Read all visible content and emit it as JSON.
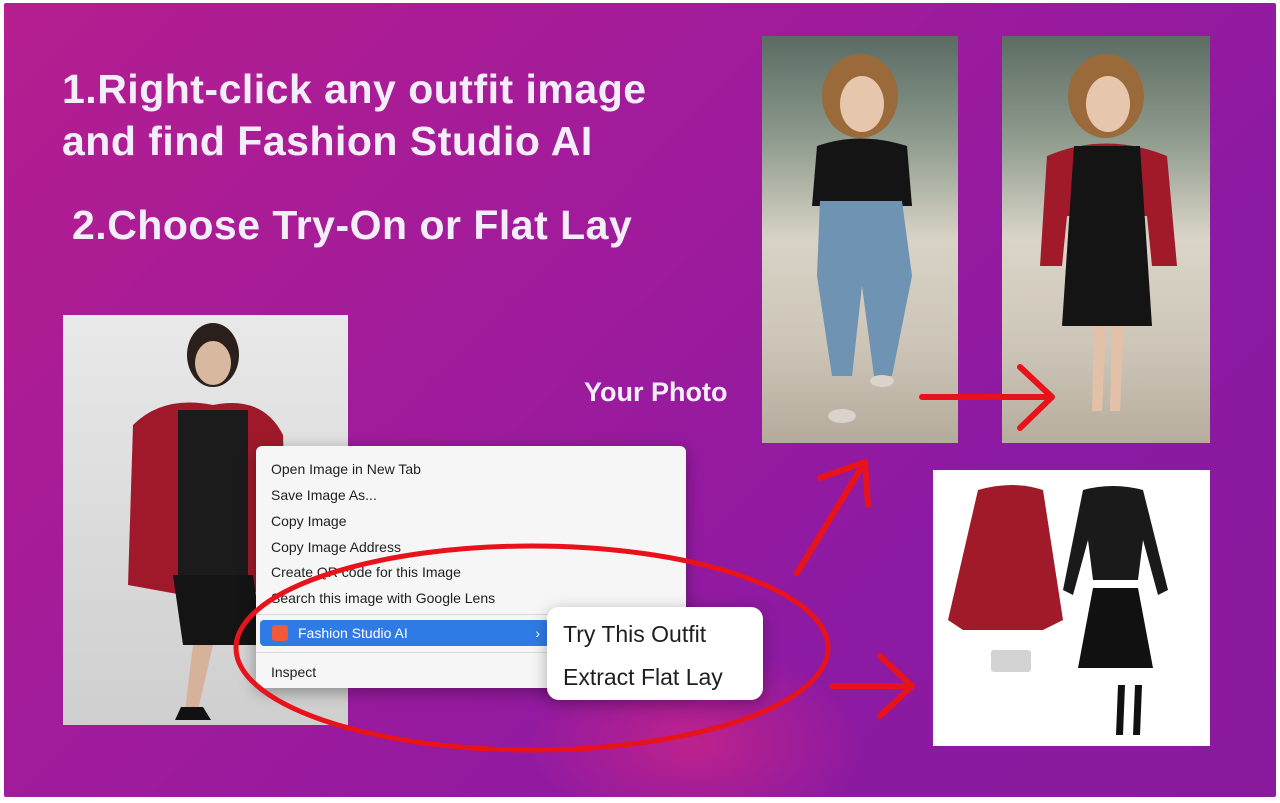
{
  "headline": {
    "line1": "1.Right-click any outfit image",
    "line2": "and find Fashion Studio AI",
    "step2": "2.Choose Try-On or Flat Lay"
  },
  "label_your_photo": "Your Photo",
  "context_menu": {
    "items": [
      "Open Image in New Tab",
      "Save Image As...",
      "Copy Image",
      "Copy Image Address",
      "Create QR code for this Image",
      "Search this image with Google Lens"
    ],
    "highlighted_item": "Fashion Studio AI",
    "inspect": "Inspect"
  },
  "submenu": {
    "try_on": "Try This Outfit",
    "flat_lay": "Extract Flat Lay"
  },
  "colors": {
    "background": "#a01b9b",
    "arrow": "#e8121b",
    "menu_highlight": "#2f7be6"
  }
}
